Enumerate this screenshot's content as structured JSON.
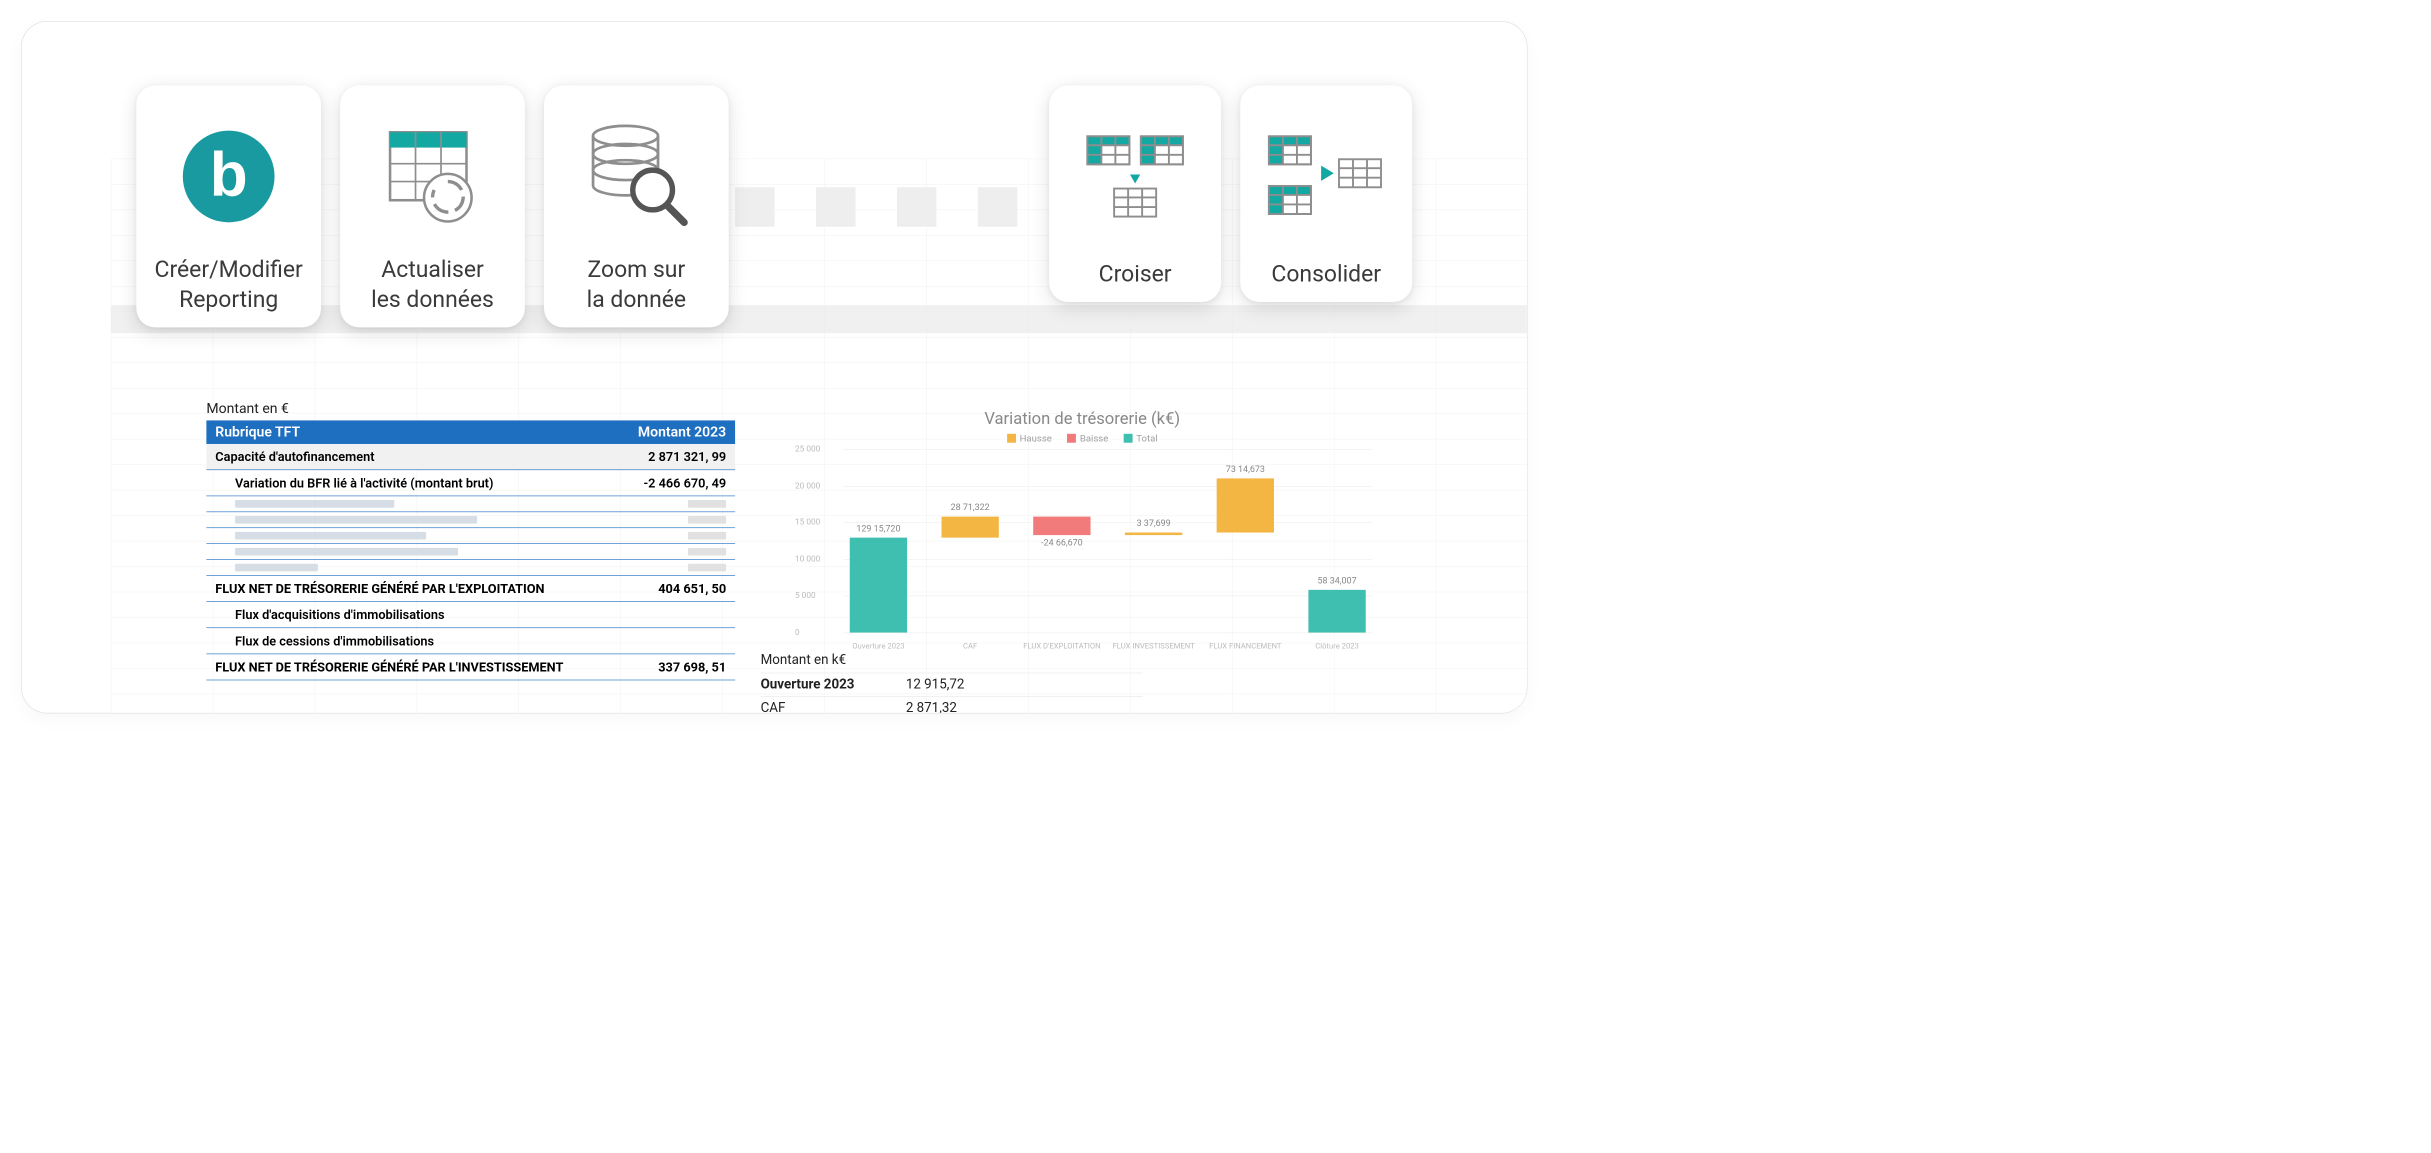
{
  "ribbon": {
    "create": "Créer/Modifier\nReporting",
    "refresh": "Actualiser\nles données",
    "zoom": "Zoom sur\nla donnée",
    "cross": "Croiser",
    "consolidate": "Consolider"
  },
  "tft": {
    "caption": "Montant en €",
    "hdr_left": "Rubrique TFT",
    "hdr_right": "Montant 2023",
    "rows": [
      {
        "label": "Capacité d'autofinancement",
        "value": "2 871 321, 99",
        "type": "band"
      },
      {
        "label": "Variation du BFR lié à l'activité (montant brut)",
        "value": "-2 466 670, 49",
        "type": "sub"
      },
      {
        "label": "FLUX NET DE TRÉSORERIE GÉNÉRÉ PAR L'EXPLOITATION",
        "value": "404 651, 50",
        "type": "flux"
      },
      {
        "label": "Flux d'acquisitions d'immobilisations",
        "value": "",
        "type": "sub"
      },
      {
        "label": "Flux de cessions d'immobilisations",
        "value": "",
        "type": "sub"
      },
      {
        "label": "FLUX NET DE TRÉSORERIE GÉNÉRÉ PAR L'INVESTISSEMENT",
        "value": "337 698, 51",
        "type": "flux"
      }
    ]
  },
  "chart_data": {
    "type": "waterfall",
    "title": "Variation de trésorerie (k€)",
    "legend": [
      "Hausse",
      "Baisse",
      "Total"
    ],
    "ylabel": "",
    "ylim": [
      0,
      25000
    ],
    "yticks": [
      0,
      5000,
      10000,
      15000,
      20000,
      25000
    ],
    "series": [
      {
        "name": "Ouverture 2023",
        "kind": "total",
        "text": "129 15,720",
        "start": 0,
        "end": 12916
      },
      {
        "name": "CAF",
        "kind": "hausse",
        "text": "28 71,322",
        "start": 12916,
        "end": 15787
      },
      {
        "name": "FLUX D'EXPLOITATION",
        "kind": "baisse",
        "text": "-24 66,670",
        "start": 15787,
        "end": 13320
      },
      {
        "name": "FLUX INVESTISSEMENT",
        "kind": "hausse",
        "text": "3 37,699",
        "start": 13320,
        "end": 13658
      },
      {
        "name": "FLUX FINANCEMENT",
        "kind": "hausse",
        "text": "73 14,673",
        "start": 13658,
        "end": 20972
      },
      {
        "name": "Clôture 2023",
        "kind": "total",
        "text": "58 34,007",
        "start": 0,
        "end": 5834
      }
    ],
    "colors": {
      "hausse": "#f4b642",
      "baisse": "#f17a7a",
      "total": "#3fbfaf"
    }
  },
  "mini": {
    "caption": "Montant en k€",
    "rows": [
      {
        "k": "Ouverture 2023",
        "v": "12 915,72"
      },
      {
        "k": "CAF",
        "v": "2 871,32"
      }
    ]
  }
}
